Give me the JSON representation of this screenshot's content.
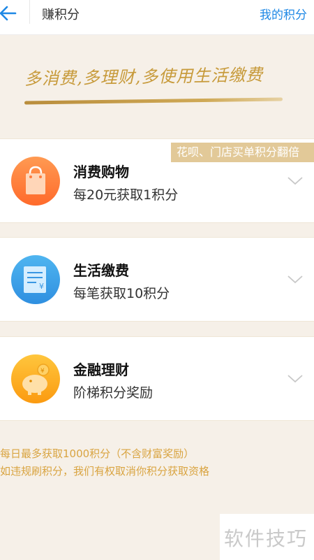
{
  "header": {
    "back_icon": "arrow-left-icon",
    "title": "赚积分",
    "right_link": "我的积分"
  },
  "banner": {
    "slogan": "多消费,多理财,多使用生活缴费"
  },
  "cards": [
    {
      "title": "消费购物",
      "description": "每20元获取1积分",
      "badge": "花呗、门店买单积分翻倍",
      "icon": "shopping-bag-icon",
      "chevron_icon": "chevron-down-icon"
    },
    {
      "title": "生活缴费",
      "description": "每笔获取10积分",
      "icon": "bill-receipt-icon",
      "chevron_icon": "chevron-down-icon"
    },
    {
      "title": "金融理财",
      "description": "阶梯积分奖励",
      "icon": "piggy-bank-icon",
      "chevron_icon": "chevron-down-icon"
    }
  ],
  "notes": [
    "每日最多获取1000积分（不含财富奖励）",
    "如违规刷积分，我们有权取消你积分获取资格"
  ],
  "watermark": "软件技巧",
  "colors": {
    "link_blue": "#1e88e5",
    "gold_text": "#d9a441",
    "badge_bg": "#e2c998",
    "page_bg": "#f6f0e8"
  }
}
